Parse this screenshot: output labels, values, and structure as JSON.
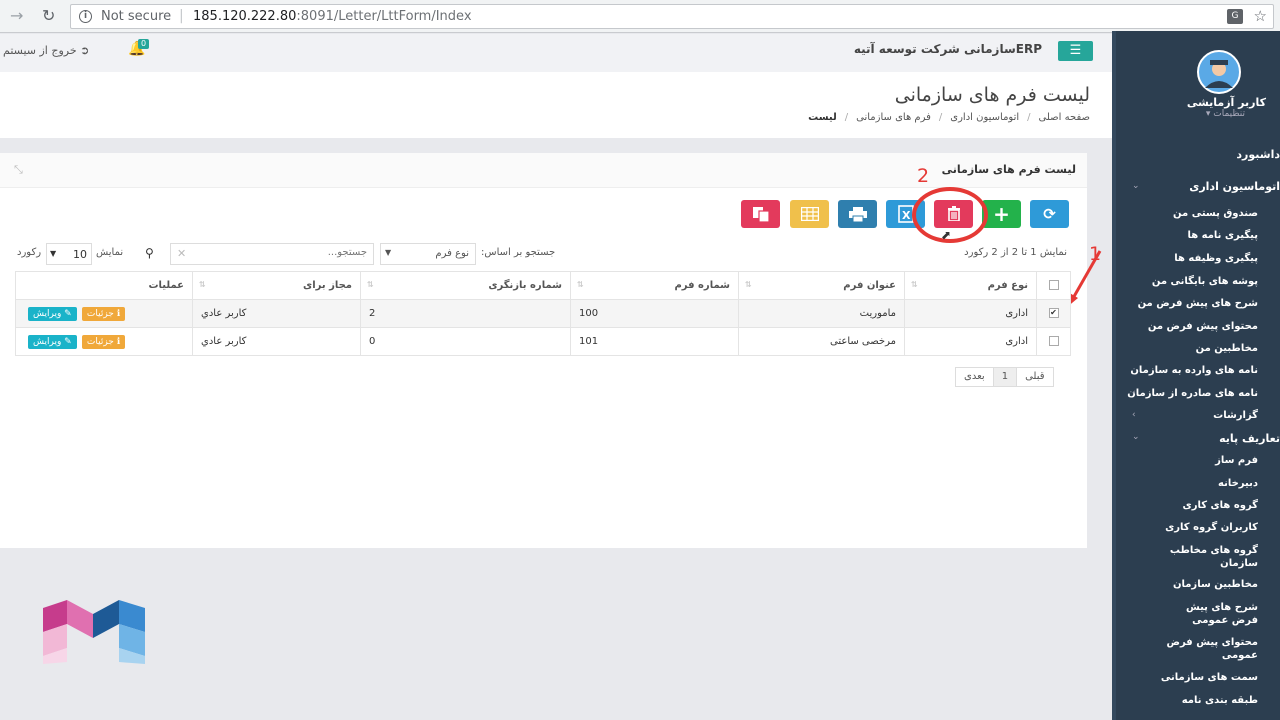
{
  "browser": {
    "not_secure": "Not secure",
    "url_host": "185.120.222.80",
    "url_rest": ":8091/Letter/LttForm/Index"
  },
  "header": {
    "company": "ERPسازمانی شرکت توسعه آتیه",
    "logout": "خروج از سیستم",
    "notifications": "0"
  },
  "page": {
    "title": "لیست فرم های سازمانی",
    "breadcrumb": [
      "صفحه اصلی",
      "اتوماسیون اداری",
      "فرم های سازمانی",
      "لیست"
    ]
  },
  "panel": {
    "title": "لیست فرم های سازمانی",
    "records_summary": "نمایش 1 تا 2 از 2 رکورد",
    "search_by_label": "جستجو بر اساس:",
    "search_field": "نوع فرم",
    "search_placeholder": "جستجو...",
    "show_label": "نمایش",
    "page_size": "10",
    "record_label": "رکورد"
  },
  "markers": {
    "one": "1",
    "two": "2"
  },
  "table": {
    "headers": [
      "نوع فرم",
      "عنوان فرم",
      "شماره فرم",
      "شماره بازنگری",
      "مجاز برای",
      "عملیات"
    ],
    "rows": [
      {
        "type": "اداری",
        "title": "ماموریت",
        "number": "100",
        "revision": "2",
        "allowed": "کاربر عادي",
        "checked": true
      },
      {
        "type": "اداری",
        "title": "مرخصی ساعتی",
        "number": "101",
        "revision": "0",
        "allowed": "کاربر عادي",
        "checked": false
      }
    ],
    "edit_label": "ویرایش",
    "details_label": "جزئیات"
  },
  "pagination": {
    "prev": "قبلی",
    "current": "1",
    "next": "بعدی"
  },
  "sidebar": {
    "username": "کاربر آزمایشی",
    "settings": "تنظیمات",
    "items": [
      "داشبورد",
      "اتوماسیون اداری",
      "صندوق پستی من",
      "پیگیری نامه ها",
      "پیگیری وظیفه ها",
      "پوشه های بایگانی من",
      "شرح های پیش فرض من",
      "محتوای پیش فرض من",
      "مخاطبین من",
      "نامه های وارده به سازمان",
      "نامه های صادره از سازمان",
      "گزارشات",
      "تعاریف پایه",
      "فرم ساز",
      "دبیرخانه",
      "گروه های کاری",
      "کاربران گروه کاری",
      "گروه های مخاطب سازمان",
      "مخاطبین سازمان",
      "شرح های پیش فرض عمومی",
      "محتوای پیش فرض عمومی",
      "سمت های سازمانی",
      "طبقه بندی نامه"
    ]
  },
  "colors": {
    "teal": "#26a69a",
    "sidebar_bg": "#2c3e50",
    "delete_red": "#e33a5c",
    "marker_red": "#e53935"
  }
}
